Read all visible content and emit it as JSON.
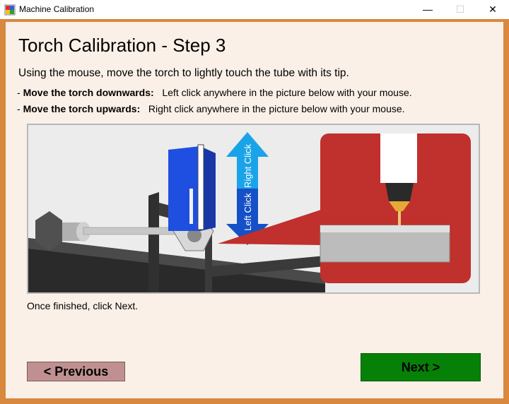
{
  "window": {
    "title": "Machine Calibration",
    "minimize": "—",
    "maximize": "☐",
    "close": "✕"
  },
  "page": {
    "heading": "Torch Calibration - Step 3",
    "intro": "Using the mouse, move the torch to lightly touch the tube with its tip.",
    "bullets": [
      {
        "prefix": "- ",
        "label": "Move the torch downwards:",
        "text": "Left click anywhere in the picture below with your mouse."
      },
      {
        "prefix": "- ",
        "label": "Move the torch upwards:",
        "text": "Right click anywhere in the picture below with your mouse."
      }
    ],
    "arrow_up_label": "Right Click",
    "arrow_down_label": "Left Click",
    "finish_text": "Once finished, click Next."
  },
  "buttons": {
    "previous": "< Previous",
    "next": "Next >"
  },
  "colors": {
    "titlebar": "#ffffff",
    "window_border": "#d8883f",
    "client_bg": "#fbf0e7",
    "previous_bg": "#c09090",
    "next_bg": "#078008",
    "arrow_up": "#1aa3e8",
    "arrow_down": "#1550c8",
    "zoom_panel": "#c0302c",
    "torch_blue": "#1f4fe0"
  }
}
